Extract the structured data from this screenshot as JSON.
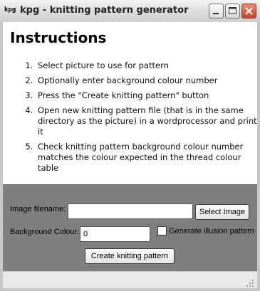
{
  "window": {
    "icon_text": "kpg",
    "title": "kpg - knitting pattern generator"
  },
  "instructions": {
    "heading": "Instructions",
    "steps": [
      "Select picture to use for pattern",
      "Optionally enter background colour number",
      "Press the \"Create knitting pattern\" button",
      "Open new knitting pattern file (that is in the same directory as the picture) in a wordprocessor and print it",
      "Check knitting pattern background colour number matches the colour expected in the thread colour table"
    ]
  },
  "form": {
    "image_label": "Image filename:",
    "image_value": "",
    "select_button": "Select Image",
    "bg_label": "Background Colour:",
    "bg_value": "0",
    "illusion_label": "Generate illusion pattern",
    "illusion_checked": false,
    "create_button": "Create knitting pattern"
  }
}
